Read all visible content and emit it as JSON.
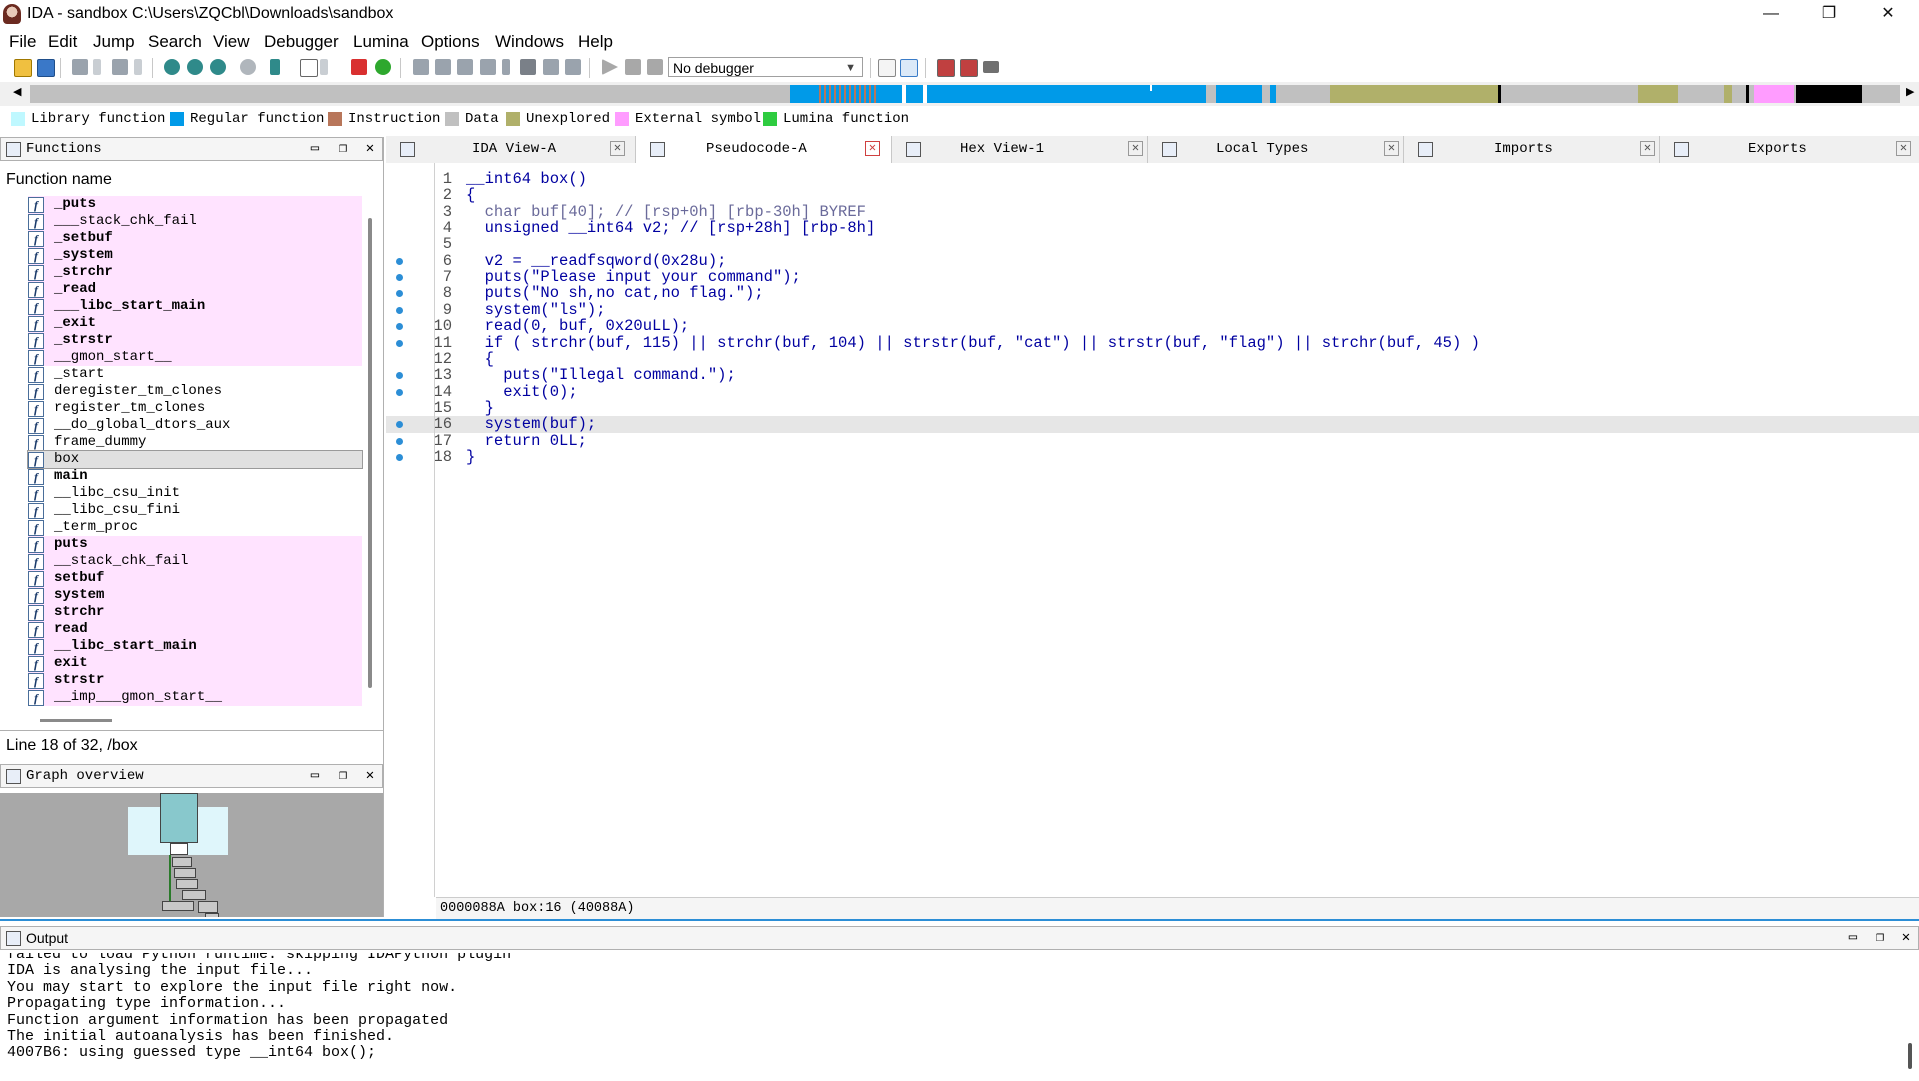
{
  "window": {
    "title": "IDA - sandbox C:\\Users\\ZQCbl\\Downloads\\sandbox",
    "minimize": "—",
    "maximize": "❐",
    "close": "✕"
  },
  "menu": [
    "File",
    "Edit",
    "Jump",
    "Search",
    "View",
    "Debugger",
    "Lumina",
    "Options",
    "Windows",
    "Help"
  ],
  "toolbar": {
    "debugger_selected": "No debugger"
  },
  "legend": [
    {
      "label": "Library function",
      "color": "#bff8ff"
    },
    {
      "label": "Regular function",
      "color": "#009ae8"
    },
    {
      "label": "Instruction",
      "color": "#b8765a"
    },
    {
      "label": "Data",
      "color": "#c0c0c0"
    },
    {
      "label": "Unexplored",
      "color": "#b0b06a"
    },
    {
      "label": "External symbol",
      "color": "#ff9cff"
    },
    {
      "label": "Lumina function",
      "color": "#2ecc40"
    }
  ],
  "functions_panel": {
    "title": "Functions",
    "column_header": "Function name",
    "items": [
      {
        "name": "_puts",
        "lib": true,
        "pink": true
      },
      {
        "name": "___stack_chk_fail",
        "lib": false,
        "pink": true
      },
      {
        "name": "_setbuf",
        "lib": true,
        "pink": true
      },
      {
        "name": "_system",
        "lib": true,
        "pink": true
      },
      {
        "name": "_strchr",
        "lib": true,
        "pink": true
      },
      {
        "name": "_read",
        "lib": true,
        "pink": true
      },
      {
        "name": "___libc_start_main",
        "lib": true,
        "pink": true
      },
      {
        "name": "_exit",
        "lib": true,
        "pink": true
      },
      {
        "name": "_strstr",
        "lib": true,
        "pink": true
      },
      {
        "name": "__gmon_start__",
        "lib": false,
        "pink": true
      },
      {
        "name": "_start",
        "lib": false,
        "pink": false
      },
      {
        "name": "deregister_tm_clones",
        "lib": false,
        "pink": false
      },
      {
        "name": "register_tm_clones",
        "lib": false,
        "pink": false
      },
      {
        "name": "__do_global_dtors_aux",
        "lib": false,
        "pink": false
      },
      {
        "name": "frame_dummy",
        "lib": false,
        "pink": false
      },
      {
        "name": "box",
        "lib": false,
        "pink": false,
        "selected": true
      },
      {
        "name": "main",
        "lib": true,
        "pink": false
      },
      {
        "name": "__libc_csu_init",
        "lib": false,
        "pink": false
      },
      {
        "name": "__libc_csu_fini",
        "lib": false,
        "pink": false
      },
      {
        "name": "_term_proc",
        "lib": false,
        "pink": false
      },
      {
        "name": "puts",
        "lib": true,
        "pink": true
      },
      {
        "name": "__stack_chk_fail",
        "lib": false,
        "pink": true
      },
      {
        "name": "setbuf",
        "lib": true,
        "pink": true
      },
      {
        "name": "system",
        "lib": true,
        "pink": true
      },
      {
        "name": "strchr",
        "lib": true,
        "pink": true
      },
      {
        "name": "read",
        "lib": true,
        "pink": true
      },
      {
        "name": "__libc_start_main",
        "lib": true,
        "pink": true
      },
      {
        "name": "exit",
        "lib": true,
        "pink": true
      },
      {
        "name": "strstr",
        "lib": true,
        "pink": true
      },
      {
        "name": "__imp___gmon_start__",
        "lib": false,
        "pink": true
      }
    ],
    "status": "Line 18 of 32, /box"
  },
  "graph_panel": {
    "title": "Graph overview"
  },
  "tabs": [
    {
      "label": "IDA View-A",
      "active": false
    },
    {
      "label": "Pseudocode-A",
      "active": true
    },
    {
      "label": "Hex View-1",
      "active": false
    },
    {
      "label": "Local Types",
      "active": false
    },
    {
      "label": "Imports",
      "active": false
    },
    {
      "label": "Exports",
      "active": false
    }
  ],
  "code": {
    "lines": [
      {
        "n": "1",
        "dot": false,
        "text": "__int64 box()"
      },
      {
        "n": "2",
        "dot": false,
        "text": "{"
      },
      {
        "n": "3",
        "dot": false,
        "text": "  char buf[40]; // [rsp+0h] [rbp-30h] BYREF"
      },
      {
        "n": "4",
        "dot": false,
        "text": "  unsigned __int64 v2; // [rsp+28h] [rbp-8h]"
      },
      {
        "n": "5",
        "dot": false,
        "text": ""
      },
      {
        "n": "6",
        "dot": true,
        "text": "  v2 = __readfsqword(0x28u);"
      },
      {
        "n": "7",
        "dot": true,
        "text": "  puts(\"Please input your command\");"
      },
      {
        "n": "8",
        "dot": true,
        "text": "  puts(\"No sh,no cat,no flag.\");"
      },
      {
        "n": "9",
        "dot": true,
        "text": "  system(\"ls\");"
      },
      {
        "n": "10",
        "dot": true,
        "text": "  read(0, buf, 0x20uLL);"
      },
      {
        "n": "11",
        "dot": true,
        "text": "  if ( strchr(buf, 115) || strchr(buf, 104) || strstr(buf, \"cat\") || strstr(buf, \"flag\") || strchr(buf, 45) )"
      },
      {
        "n": "12",
        "dot": false,
        "text": "  {"
      },
      {
        "n": "13",
        "dot": true,
        "text": "    puts(\"Illegal command.\");"
      },
      {
        "n": "14",
        "dot": true,
        "text": "    exit(0);"
      },
      {
        "n": "15",
        "dot": false,
        "text": "  }"
      },
      {
        "n": "16",
        "dot": true,
        "text": "  system(buf);",
        "highlight": true
      },
      {
        "n": "17",
        "dot": true,
        "text": "  return 0LL;"
      },
      {
        "n": "18",
        "dot": true,
        "text": "}"
      }
    ],
    "status": "0000088A box:16 (40088A)"
  },
  "output": {
    "title": "Output",
    "lines": [
      "failed to load Python runtime: skipping IDAPython plugin",
      "IDA is analysing the input file...",
      "You may start to explore the input file right now.",
      "Propagating type information...",
      "Function argument information has been propagated",
      "The initial autoanalysis has been finished.",
      "4007B6: using guessed type __int64 box();"
    ]
  }
}
